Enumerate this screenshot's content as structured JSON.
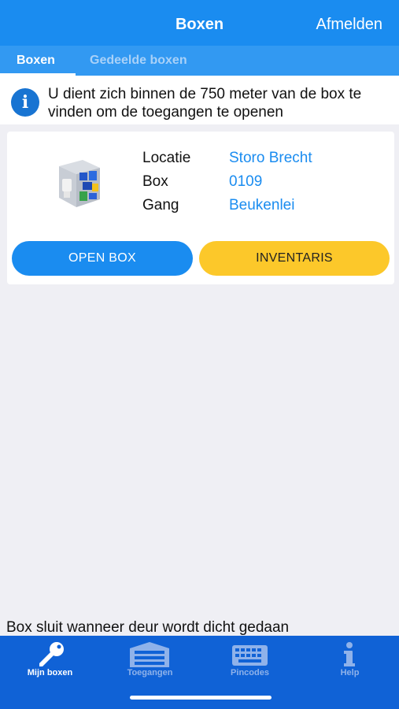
{
  "navbar": {
    "title": "Boxen",
    "logout_label": "Afmelden"
  },
  "top_tabs": [
    {
      "label": "Boxen",
      "active": true
    },
    {
      "label": "Gedeelde boxen",
      "active": false
    }
  ],
  "info": {
    "icon": "info-icon",
    "text": "U dient zich binnen de 750 meter van de box te vinden om de toegangen te openen"
  },
  "box_card": {
    "rows": [
      {
        "label": "Locatie",
        "value": "Storo Brecht"
      },
      {
        "label": "Box",
        "value": "0109"
      },
      {
        "label": "Gang",
        "value": "Beukenlei"
      }
    ],
    "open_button": "OPEN BOX",
    "inventory_button": "INVENTARIS"
  },
  "footer_note": "Box sluit wanneer deur wordt dicht gedaan",
  "bottom_tabs": [
    {
      "label": "Mijn boxen",
      "icon": "key-icon",
      "active": true
    },
    {
      "label": "Toegangen",
      "icon": "garage-door-icon",
      "active": false
    },
    {
      "label": "Pincodes",
      "icon": "keyboard-icon",
      "active": false
    },
    {
      "label": "Help",
      "icon": "info-icon",
      "active": false
    }
  ],
  "colors": {
    "primary": "#1a8cf0",
    "tabbar": "#1062d6",
    "accent_yellow": "#fcc82a"
  }
}
